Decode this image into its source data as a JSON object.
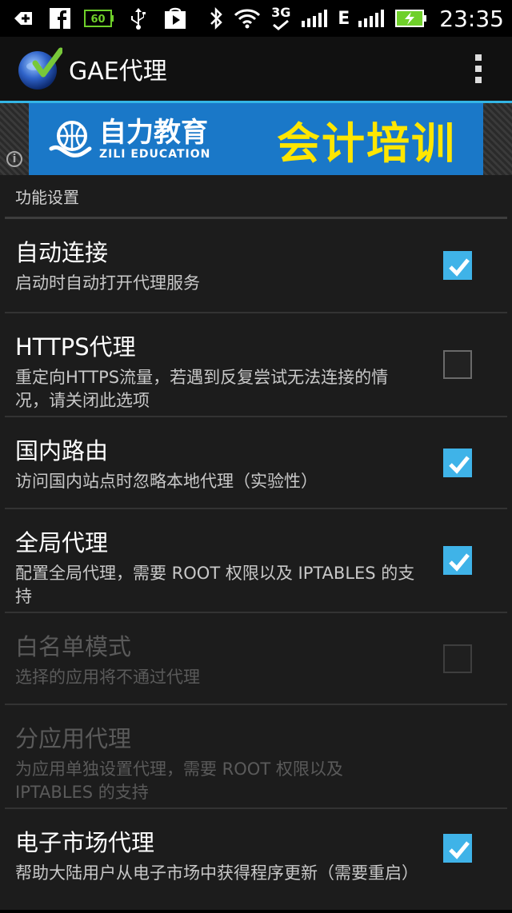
{
  "status_bar": {
    "icons": [
      "add-icon",
      "facebook-icon",
      "battery-level-icon",
      "usb-icon",
      "play-store-icon",
      "bluetooth-icon",
      "wifi-icon",
      "data-3g-icon",
      "signal-1-icon",
      "signal-2-icon",
      "battery-charging-icon"
    ],
    "battery_badge": "60",
    "network_3g": "3G",
    "network_e": "E",
    "time": "23:35"
  },
  "action_bar": {
    "title": "GAE代理"
  },
  "ad": {
    "brand_cn": "自力教育",
    "brand_en": "ZILI EDUCATION",
    "slogan": "会计培训",
    "info_glyph": "i"
  },
  "settings": {
    "section_title": "功能设置",
    "items": [
      {
        "title": "自动连接",
        "summary": "启动时自动打开代理服务",
        "checked": true,
        "enabled": true
      },
      {
        "title": "HTTPS代理",
        "summary": "重定向HTTPS流量，若遇到反复尝试无法连接的情况，请关闭此选项",
        "checked": false,
        "enabled": true
      },
      {
        "title": "国内路由",
        "summary": "访问国内站点时忽略本地代理（实验性）",
        "checked": true,
        "enabled": true
      },
      {
        "title": "全局代理",
        "summary": "配置全局代理，需要 ROOT 权限以及 IPTABLES 的支持",
        "checked": true,
        "enabled": true
      },
      {
        "title": "白名单模式",
        "summary": "选择的应用将不通过代理",
        "checked": false,
        "enabled": false
      },
      {
        "title": "分应用代理",
        "summary": "为应用单独设置代理，需要 ROOT 权限以及 IPTABLES 的支持",
        "checked": false,
        "enabled": false
      },
      {
        "title": "电子市场代理",
        "summary": "帮助大陆用户从电子市场中获得程序更新（需要重启）",
        "checked": true,
        "enabled": true
      }
    ]
  },
  "colors": {
    "accent": "#33b5e5",
    "checkbox_checked": "#3fb3e8",
    "ad_background": "#1a78c8",
    "ad_slogan": "#ffe600",
    "battery_green": "#6fd02a"
  }
}
